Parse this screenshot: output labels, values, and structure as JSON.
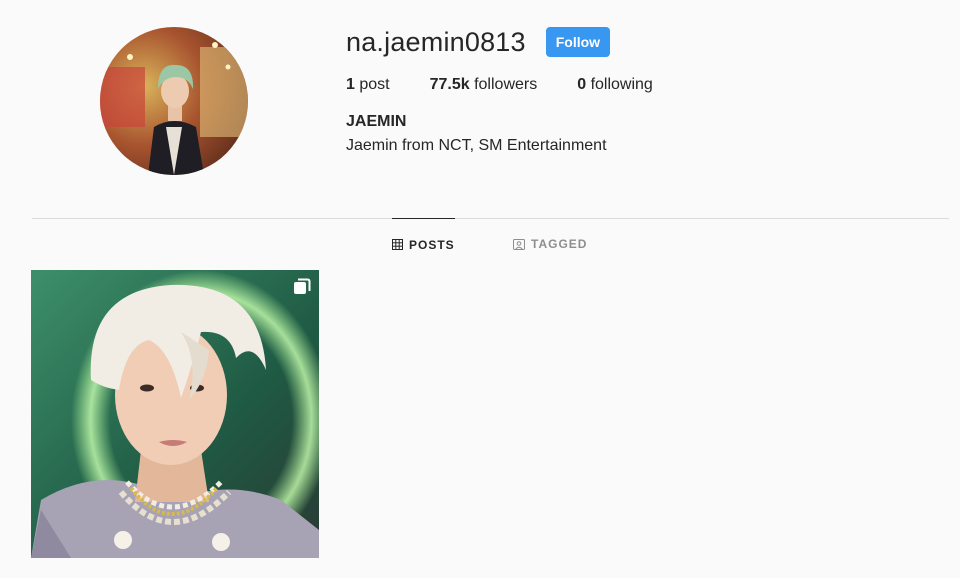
{
  "profile": {
    "username": "na.jaemin0813",
    "follow_label": "Follow",
    "full_name": "JAEMIN",
    "bio": "Jaemin from NCT, SM Entertainment",
    "avatar_icon": "profile-photo"
  },
  "stats": {
    "posts_count": "1",
    "posts_label": " post",
    "followers_count": "77.5k",
    "followers_label": " followers",
    "following_count": "0",
    "following_label": " following"
  },
  "tabs": [
    {
      "label": "POSTS",
      "icon": "grid-icon",
      "active": true
    },
    {
      "label": "TAGGED",
      "icon": "tag-icon",
      "active": false
    }
  ],
  "posts": [
    {
      "icon": "multi-photo-icon"
    }
  ],
  "colors": {
    "accent": "#3897f0",
    "background": "#fafafa",
    "text": "#262626",
    "muted": "#8e8e8e",
    "divider": "#dbdbdb"
  }
}
